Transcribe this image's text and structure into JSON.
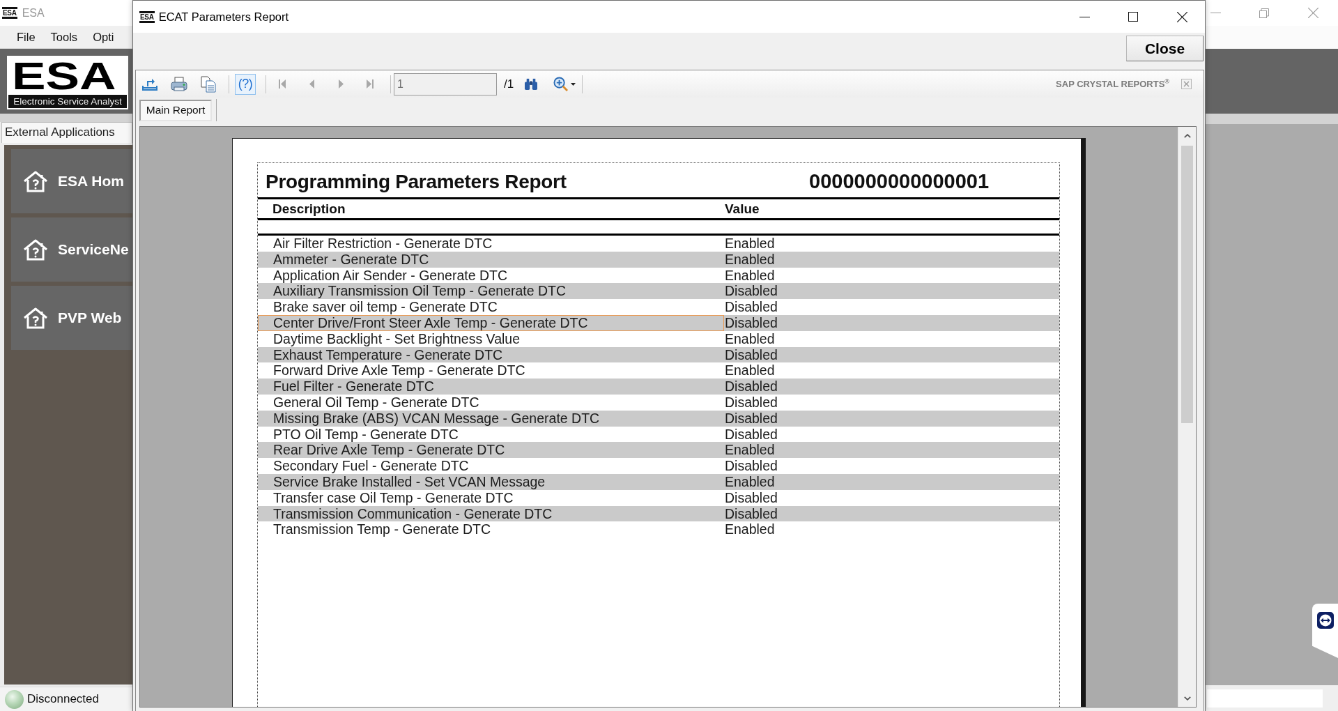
{
  "main_window": {
    "app_icon": "ESA",
    "title": "ESA",
    "active": false,
    "menu": [
      "File",
      "Tools",
      "Opti"
    ],
    "logo": {
      "title": "ESA",
      "subtitle": "Electronic Service Analyst"
    },
    "panel_header": "External Applications",
    "sidebar": {
      "items": [
        {
          "label": "ESA Hom"
        },
        {
          "label": "ServiceNe"
        },
        {
          "label": "PVP Web"
        }
      ]
    },
    "status_bar": {
      "text": "Disconnected"
    }
  },
  "dialog": {
    "app_icon": "ESA",
    "title": "ECAT Parameters Report",
    "active": true,
    "close_button": "Close",
    "viewer": {
      "toolbar": {
        "groups": [
          {
            "buttons": [
              {
                "kind": "export",
                "disabled": false,
                "highlighted": false
              },
              {
                "kind": "print",
                "disabled": false,
                "highlighted": false
              },
              {
                "kind": "copy",
                "disabled": false,
                "highlighted": false
              }
            ]
          },
          {
            "buttons": [
              {
                "kind": "help",
                "label": "(?)",
                "disabled": false,
                "highlighted": true
              }
            ]
          },
          {
            "buttons": [
              {
                "kind": "first",
                "disabled": true,
                "highlighted": false
              },
              {
                "kind": "previous",
                "disabled": true,
                "highlighted": false
              },
              {
                "kind": "next",
                "disabled": true,
                "highlighted": false
              },
              {
                "kind": "last",
                "disabled": true,
                "highlighted": false
              }
            ]
          }
        ],
        "page_field": {
          "value": "1",
          "disabled": true
        },
        "page_count": "/1",
        "tools": [
          {
            "kind": "find",
            "disabled": false,
            "highlighted": false
          },
          {
            "kind": "zoom",
            "disabled": false,
            "highlighted": false
          }
        ],
        "brand": "SAP CRYSTAL REPORTS$^{®}$"
      },
      "tabs": [
        {
          "label": "Main Report",
          "selected": true
        }
      ],
      "report": {
        "title": "Programming Parameters Report",
        "serial": "0000000000000001",
        "columns": [
          "Description",
          "Value"
        ],
        "rows": [
          {
            "description": "Air Filter Restriction - Generate DTC",
            "value": "Enabled",
            "selected": false
          },
          {
            "description": "Ammeter - Generate DTC",
            "value": "Enabled",
            "selected": false
          },
          {
            "description": "Application Air Sender - Generate DTC",
            "value": "Enabled",
            "selected": false
          },
          {
            "description": "Auxiliary Transmission Oil Temp - Generate DTC",
            "value": "Disabled",
            "selected": false
          },
          {
            "description": "Brake saver oil temp - Generate DTC",
            "value": "Disabled",
            "selected": false
          },
          {
            "description": "Center Drive/Front Steer Axle Temp - Generate DTC",
            "value": "Disabled",
            "selected": true
          },
          {
            "description": "Daytime Backlight - Set Brightness Value",
            "value": "Enabled",
            "selected": false
          },
          {
            "description": "Exhaust Temperature - Generate DTC",
            "value": "Disabled",
            "selected": false
          },
          {
            "description": "Forward Drive Axle Temp - Generate DTC",
            "value": "Enabled",
            "selected": false
          },
          {
            "description": "Fuel Filter - Generate DTC",
            "value": "Disabled",
            "selected": false
          },
          {
            "description": "General Oil Temp - Generate DTC",
            "value": "Disabled",
            "selected": false
          },
          {
            "description": "Missing Brake (ABS) VCAN Message - Generate DTC",
            "value": "Disabled",
            "selected": false
          },
          {
            "description": "PTO Oil Temp - Generate DTC",
            "value": "Disabled",
            "selected": false
          },
          {
            "description": "Rear Drive Axle Temp - Generate DTC",
            "value": "Enabled",
            "selected": false
          },
          {
            "description": "Secondary Fuel - Generate DTC",
            "value": "Disabled",
            "selected": false
          },
          {
            "description": "Service Brake Installed - Set VCAN Message",
            "value": "Enabled",
            "selected": false
          },
          {
            "description": "Transfer case Oil Temp - Generate DTC",
            "value": "Disabled",
            "selected": false
          },
          {
            "description": "Transmission Communication - Generate DTC",
            "value": "Disabled",
            "selected": false
          },
          {
            "description": "Transmission Temp - Generate DTC",
            "value": "Enabled",
            "selected": false
          }
        ]
      }
    }
  }
}
